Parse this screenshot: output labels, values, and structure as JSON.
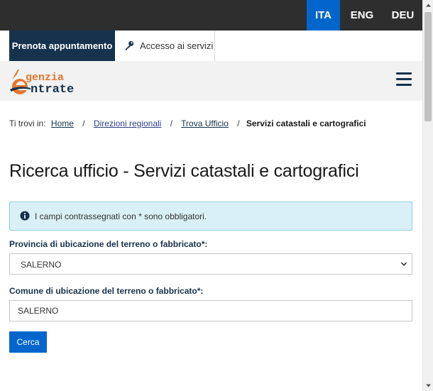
{
  "languages": [
    {
      "label": "ITA",
      "active": true
    },
    {
      "label": "ENG",
      "active": false
    },
    {
      "label": "DEU",
      "active": false
    }
  ],
  "servicebar": {
    "prenota_label": "Prenota appuntamento",
    "accesso_label": "Accesso ai servizi",
    "accesso_icon": "key-icon"
  },
  "header": {
    "logo_line1": "genzia",
    "logo_line2": "ntrate",
    "logo_colors": {
      "orange": "#e3762e",
      "blue": "#17324d"
    },
    "menu_icon": "hamburger-menu-icon"
  },
  "breadcrumb": {
    "prefix": "Ti trovi in:",
    "items": [
      "Home",
      "Direzioni regionali",
      "Trova Ufficio"
    ],
    "separator": "/",
    "current": "Servizi catastali e cartografici"
  },
  "page_title": "Ricerca ufficio - Servizi catastali e cartografici",
  "alert": {
    "icon": "info-circle-icon",
    "text": "I campi contrassegnati con * sono obbligatori."
  },
  "form": {
    "provincia_label": "Provincia di ubicazione del terreno o fabbricato*:",
    "provincia_value": "SALERNO",
    "comune_label": "Comune di ubicazione del terreno o fabbricato*:",
    "comune_value": "SALERNO",
    "submit_label": "Cerca"
  },
  "colors": {
    "accent": "#0066cc",
    "dark_navy": "#17324d",
    "top_bar": "#2e2e2e",
    "alert_bg": "#d9f0f6"
  }
}
